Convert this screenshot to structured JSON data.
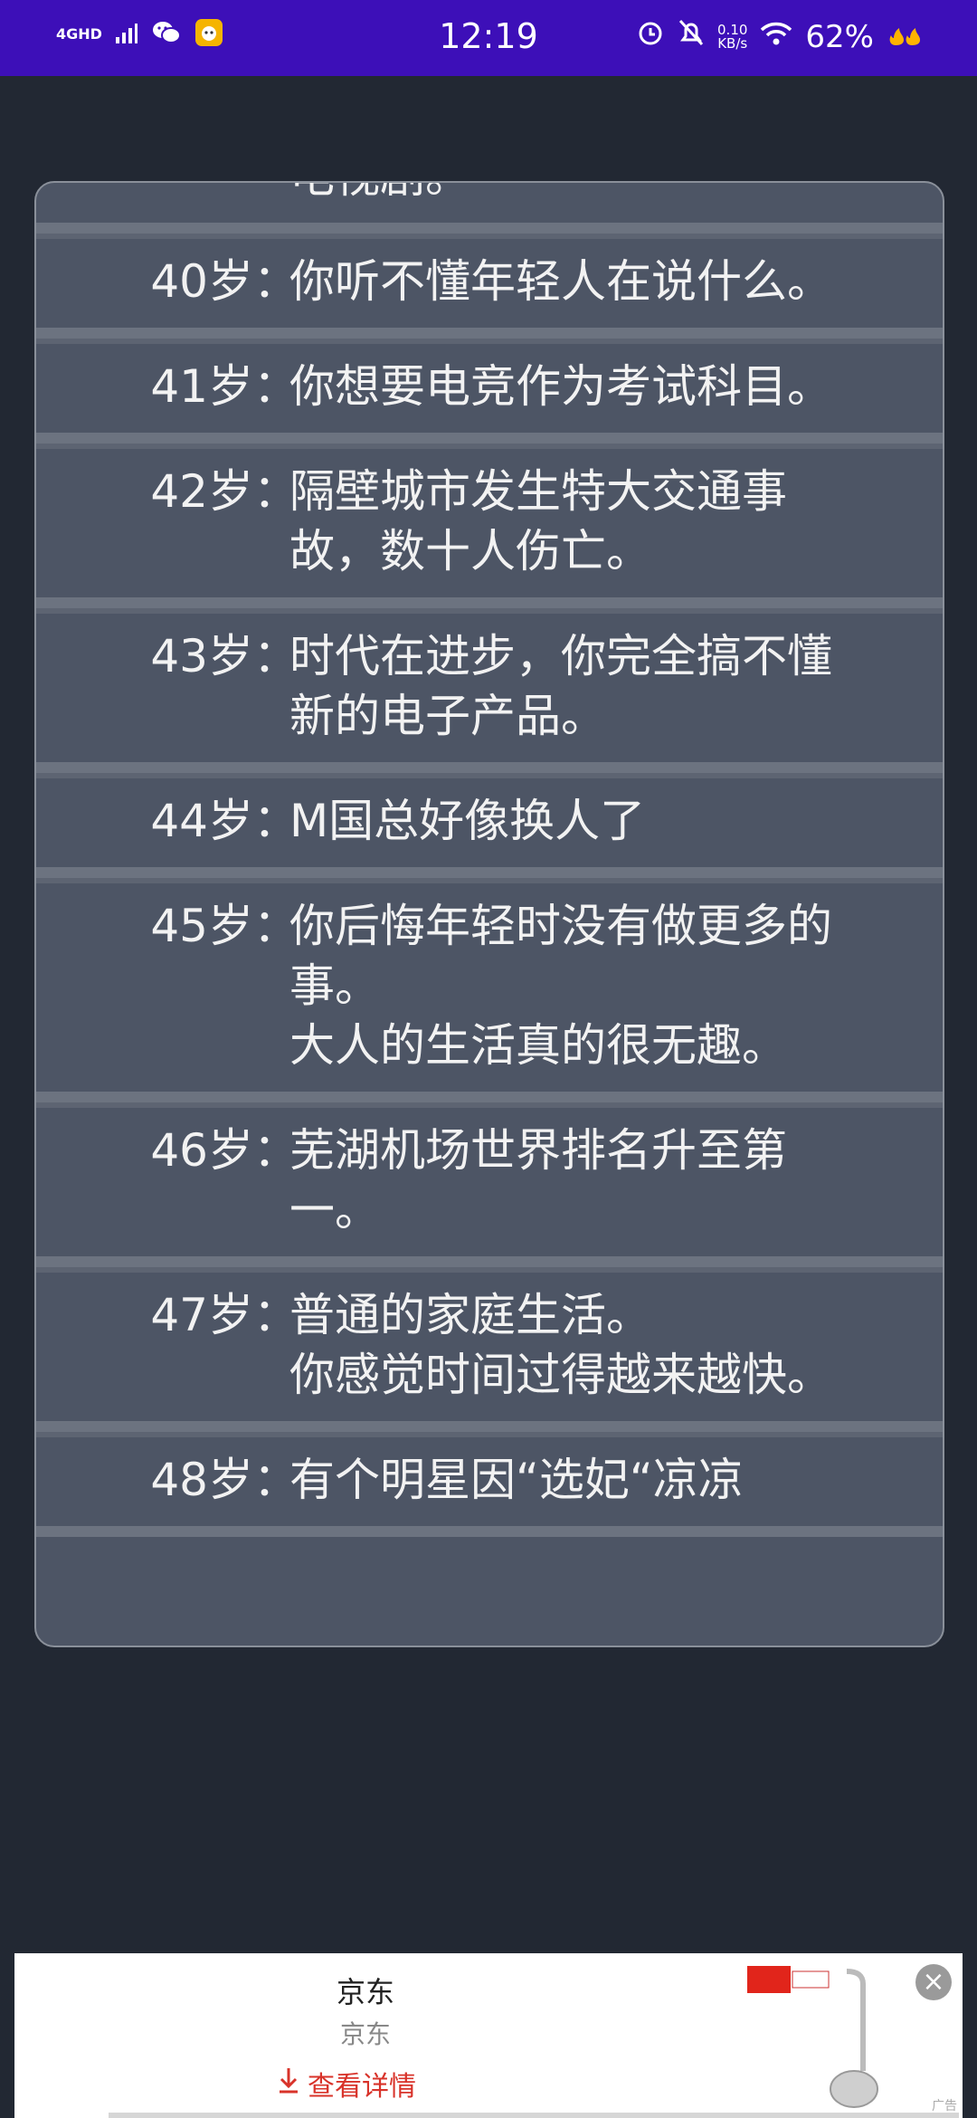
{
  "status": {
    "network": "4GHD",
    "time": "12:19",
    "speed_value": "0.10",
    "speed_unit": "KB/s",
    "battery": "62%"
  },
  "list_rows": [
    {
      "age": "",
      "event": "电视剧。"
    },
    {
      "age": "40岁",
      "event": "你听不懂年轻人在说什么。"
    },
    {
      "age": "41岁",
      "event": "你想要电竞作为考试科目。"
    },
    {
      "age": "42岁",
      "event": "隔壁城市发生特大交通事\n故，数十人伤亡。"
    },
    {
      "age": "43岁",
      "event": "时代在进步，你完全搞不懂\n新的电子产品。"
    },
    {
      "age": "44岁",
      "event": "M国总好像换人了"
    },
    {
      "age": "45岁",
      "event": "你后悔年轻时没有做更多的\n事。\n大人的生活真的很无趣。"
    },
    {
      "age": "46岁",
      "event": "芜湖机场世界排名升至第\n一。"
    },
    {
      "age": "47岁",
      "event": "普通的家庭生活。\n你感觉时间过得越来越快。"
    },
    {
      "age": "48岁",
      "event": "有个明星因“选妃“凉凉"
    }
  ],
  "colon": "：",
  "ad": {
    "title": "京东",
    "subtitle": "京东",
    "button": "查看详情",
    "tag": "广告"
  },
  "colors": {
    "status_bar": "#3d0fb8",
    "background": "#222833",
    "panel": "#4d5565",
    "accent_red": "#d8332a"
  }
}
